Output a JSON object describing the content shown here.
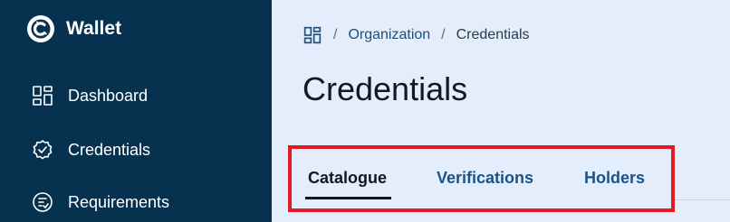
{
  "app": {
    "name": "Wallet",
    "logo_icon": "wallet-logo-icon"
  },
  "sidebar": {
    "items": [
      {
        "label": "Dashboard",
        "icon": "dashboard-icon"
      },
      {
        "label": "Credentials",
        "icon": "badge-check-icon"
      },
      {
        "label": "Requirements",
        "icon": "requirements-icon"
      }
    ]
  },
  "breadcrumb": {
    "items": [
      "Organization",
      "Credentials"
    ],
    "separator": "/"
  },
  "page": {
    "title": "Credentials"
  },
  "tabs": {
    "items": [
      {
        "label": "Catalogue",
        "active": true
      },
      {
        "label": "Verifications",
        "active": false
      },
      {
        "label": "Holders",
        "active": false
      }
    ]
  },
  "colors": {
    "sidebar_bg": "#07324f",
    "main_bg": "#e3edfb",
    "tab_active": "#111820",
    "tab_inactive": "#175489",
    "highlight_border": "#e21b23"
  }
}
